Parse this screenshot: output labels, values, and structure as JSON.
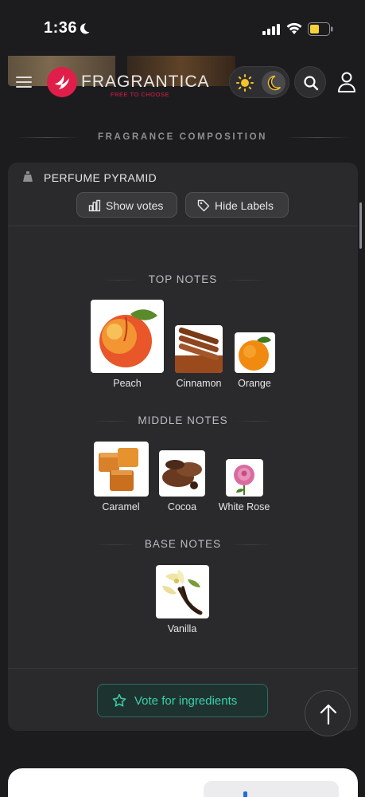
{
  "status_bar": {
    "time": "1:36",
    "icons": [
      "moon-icon",
      "signal-icon",
      "wifi-icon",
      "battery-icon"
    ]
  },
  "header": {
    "brand_name": "FRAGRANTICA",
    "brand_tagline": "FREE TO CHOOSE",
    "brand_color": "#e01e4a",
    "icons": [
      "menu-icon",
      "sun-icon",
      "moon-icon",
      "search-icon",
      "user-icon"
    ]
  },
  "section": {
    "title": "FRAGRANCE COMPOSITION"
  },
  "pyramid": {
    "title": "PERFUME PYRAMID",
    "show_votes_label": "Show votes",
    "hide_labels_label": "Hide Labels",
    "top_heading": "TOP NOTES",
    "middle_heading": "MIDDLE NOTES",
    "base_heading": "BASE NOTES",
    "top_notes": [
      {
        "label": "Peach"
      },
      {
        "label": "Cinnamon"
      },
      {
        "label": "Orange"
      }
    ],
    "middle_notes": [
      {
        "label": "Caramel"
      },
      {
        "label": "Cocoa"
      },
      {
        "label": "White Rose"
      }
    ],
    "base_notes": [
      {
        "label": "Vanilla"
      }
    ],
    "vote_label": "Vote for ingredients",
    "accent_color": "#3ccfae"
  }
}
